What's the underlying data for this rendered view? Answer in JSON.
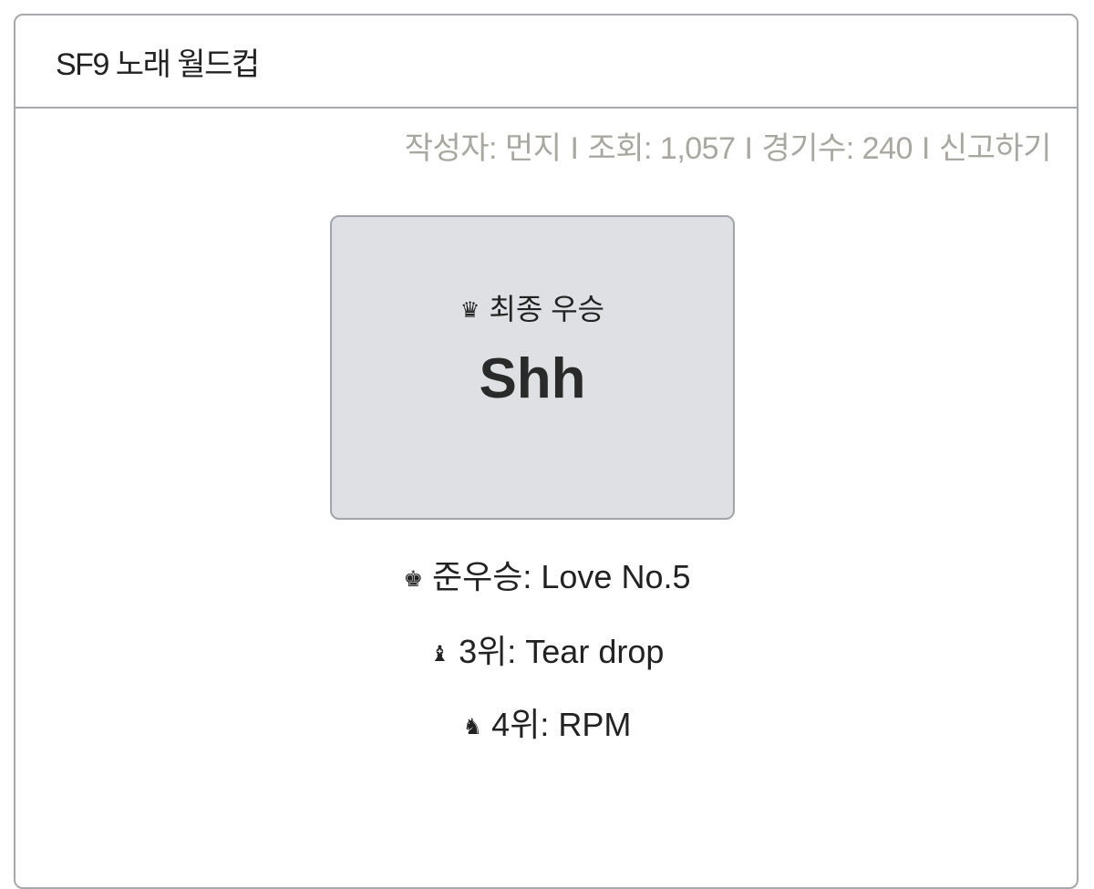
{
  "header": {
    "title": "SF9 노래 월드컵"
  },
  "meta": {
    "author_label": "작성자: 먼지",
    "separator": "I",
    "views_label": "조회: 1,057",
    "matches_label": "경기수: 240",
    "report_label": "신고하기"
  },
  "winner": {
    "icon": "♛",
    "icon_name": "queen-crown-icon",
    "label": "최종 우승",
    "name": "Shh"
  },
  "rankings": [
    {
      "icon": "♚",
      "icon_name": "king-crown-icon",
      "text": "준우승: Love No.5"
    },
    {
      "icon": "♝",
      "icon_name": "bishop-piece-icon",
      "text": "3위: Tear drop"
    },
    {
      "icon": "♞",
      "icon_name": "knight-piece-icon",
      "text": "4위: RPM"
    }
  ],
  "colors": {
    "border": "#a7a7ae",
    "meta_text": "#a8a8a0",
    "winner_bg": "#dfe0e4",
    "text": "#222222"
  }
}
